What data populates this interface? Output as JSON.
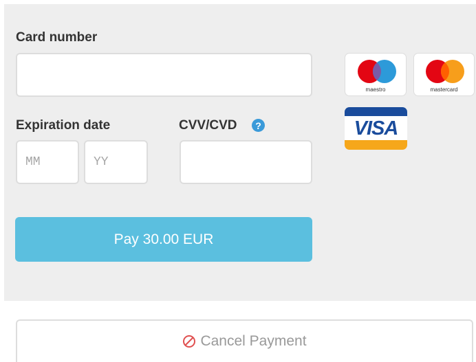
{
  "form": {
    "card_number_label": "Card number",
    "expiration_label": "Expiration date",
    "month_placeholder": "MM",
    "year_placeholder": "YY",
    "cvv_label": "CVV/CVD",
    "help_glyph": "?",
    "pay_label": "Pay 30.00 EUR",
    "cancel_label": "Cancel Payment"
  },
  "brands": {
    "maestro": {
      "caption": "maestro",
      "colors": [
        "#e30613",
        "#2d9ad9",
        "#7a5ba8"
      ]
    },
    "mastercard": {
      "caption": "mastercard",
      "colors": [
        "#e30613",
        "#f79e1b",
        "#ff5f00"
      ]
    },
    "visa": {
      "word": "VISA",
      "colors": [
        "#1a4c9c",
        "#f6a71b"
      ]
    }
  },
  "colors": {
    "pay_button": "#5bbfdf",
    "help_icon": "#3a9ad9",
    "cancel_icon": "#e05050",
    "panel": "#eeeeee"
  }
}
